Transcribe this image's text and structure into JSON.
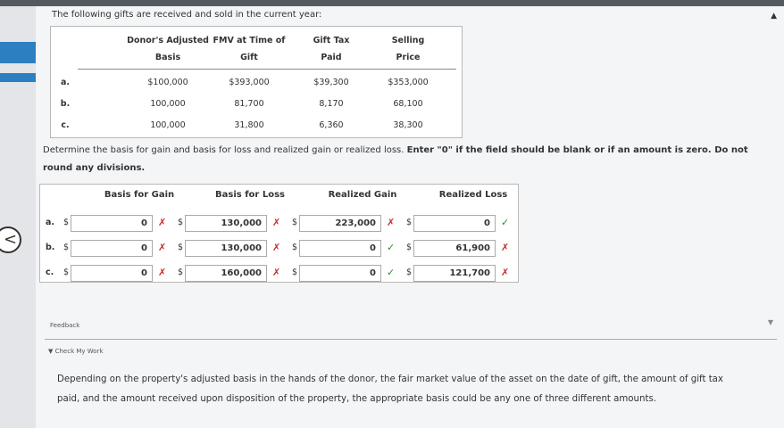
{
  "intro": "The following gifts are received and sold in the current year:",
  "gifts_table": {
    "headers": [
      [
        "Donor's Adjusted",
        "Basis"
      ],
      [
        "FMV at Time of",
        "Gift"
      ],
      [
        "Gift Tax",
        "Paid"
      ],
      [
        "Selling",
        "Price"
      ]
    ],
    "rows": [
      {
        "label": "a.",
        "cells": [
          "$100,000",
          "$393,000",
          "$39,300",
          "$353,000"
        ]
      },
      {
        "label": "b.",
        "cells": [
          "100,000",
          "81,700",
          "8,170",
          "68,100"
        ]
      },
      {
        "label": "c.",
        "cells": [
          "100,000",
          "31,800",
          "6,360",
          "38,300"
        ]
      }
    ]
  },
  "instructions": {
    "part1": "Determine the basis for gain and basis for loss and realized gain or realized loss. ",
    "part2": "Enter \"0\" if the field should be blank or if an amount is zero. Do not round any divisions."
  },
  "answer_table": {
    "headers": [
      "Basis for Gain",
      "Basis for Loss",
      "Realized Gain",
      "Realized Loss"
    ],
    "currency": "$",
    "rows": [
      {
        "label": "a.",
        "values": [
          "0",
          "130,000",
          "223,000",
          "0"
        ],
        "marks": [
          "✗",
          "✗",
          "✗",
          "✓"
        ]
      },
      {
        "label": "b.",
        "values": [
          "0",
          "130,000",
          "0",
          "61,900"
        ],
        "marks": [
          "✗",
          "✗",
          "✓",
          "✗"
        ]
      },
      {
        "label": "c.",
        "values": [
          "0",
          "160,000",
          "0",
          "121,700"
        ],
        "marks": [
          "✗",
          "✗",
          "✓",
          "✗"
        ]
      }
    ]
  },
  "feedback": {
    "label": "Feedback",
    "check_my_work": "▼ Check My Work",
    "text": "Depending on the property's adjusted basis in the hands of the donor, the fair market value of the asset on the date of gift, the amount of gift tax paid, and the amount received upon disposition of the property, the appropriate basis could be any one of three different amounts."
  },
  "icons": {
    "back": "chevron-left-icon",
    "scroll_up": "triangle-up-icon",
    "scroll_down": "triangle-down-icon"
  },
  "colors": {
    "wrong": "#cc2b2b",
    "correct": "#2f8a2f",
    "accent": "#2c7fc0"
  }
}
